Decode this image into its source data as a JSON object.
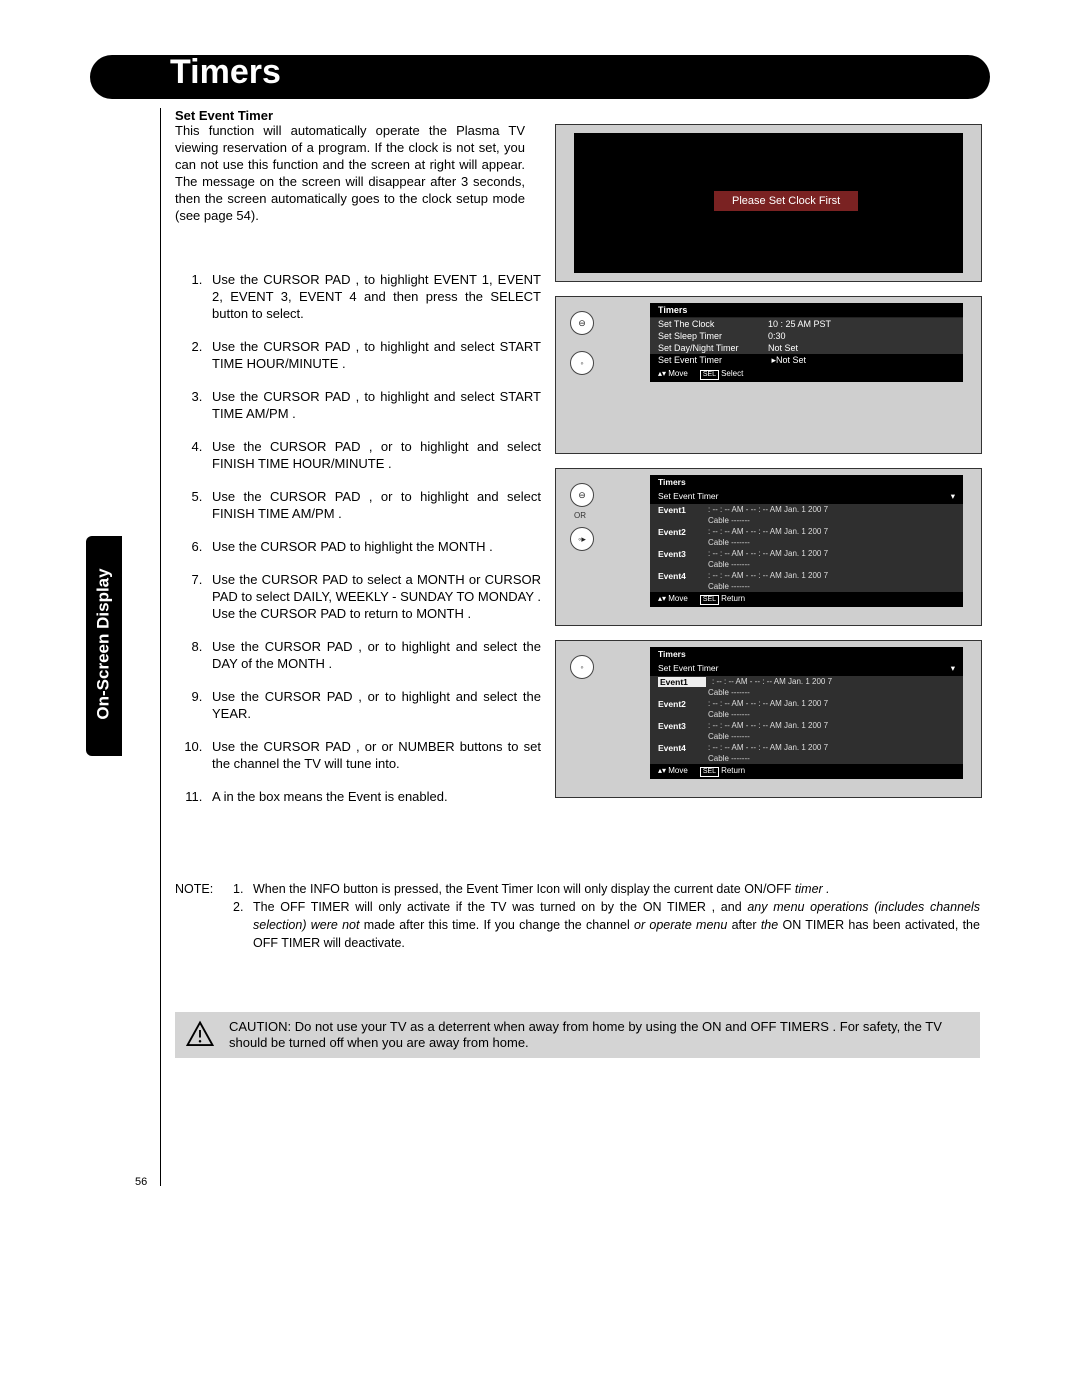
{
  "page": {
    "number": "56",
    "header": "Timers",
    "sideTab": "On-Screen Display"
  },
  "section": {
    "subhead": "Set Event Timer",
    "intro": "This function will automatically operate the Plasma TV viewing reservation of a program. If the clock is not set, you can not use this function and the screen at right will appear. The message on the screen will disappear after 3 seconds, then the screen automatically goes to the clock setup mode (see page 54).",
    "steps": [
      "Use the CURSOR PAD   ,    to highlight EVENT 1, EVENT 2, EVENT 3, EVENT 4 and then press the SELECT button to select.",
      "Use the CURSOR PAD   ,    to highlight and select START TIME HOUR/MINUTE .",
      "Use the CURSOR PAD   ,    to highlight and select START TIME AM/PM .",
      "Use the CURSOR PAD   ,   or    to highlight and select FINISH TIME HOUR/MINUTE .",
      "Use the CURSOR PAD   ,   or    to highlight and select FINISH TIME AM/PM .",
      "Use the CURSOR PAD    to highlight the MONTH .",
      "Use the CURSOR PAD    to select a MONTH  or CURSOR PAD    to select DAILY,  WEEKLY - SUNDAY TO MONDAY . Use the CURSOR PAD    to return to MONTH .",
      "Use the CURSOR PAD   ,   or    to highlight and select the DAY of the MONTH .",
      "Use the CURSOR PAD   ,   or    to highlight and select the YEAR.",
      "Use the CURSOR PAD   ,   or   or NUMBER buttons to set the channel the TV will tune into.",
      "A     in the box means the Event is enabled."
    ]
  },
  "notes": {
    "label": "NOTE:",
    "items": [
      "When the INFO button is pressed, the Event Timer Icon will only display the current date   ON/OFF",
      "The OFF TIMER  will only activate if the TV was turned on by the   ON TIMER ,  and"
    ],
    "item1_tail": "timer .",
    "item2_tail": "any menu operations (includes channels selection) were not",
    "item2_mid": "made after this time. If you change the channel",
    "item2_mid2": "or operate menu",
    "item2_after": "after",
    "item2_line3a": "the",
    "item2_line3b": "ON TIMER has been",
    "item2_line3c": "activated, the  OFF TIMER  will deactivate."
  },
  "caution": "CAUTION:  Do not use your TV as a deterrent when away from home by using the   ON and OFF TIMERS . For safety, the TV should be turned off when you are away from home.",
  "tv1_msg": "Please Set Clock First",
  "orLabel": "OR",
  "menuTimers": {
    "title": "Timers",
    "rows": [
      {
        "k": "Set The Clock",
        "v": "10 : 25 AM PST"
      },
      {
        "k": "Set Sleep Timer",
        "v": "0:30"
      },
      {
        "k": "Set Day/Night Timer",
        "v": "Not Set"
      },
      {
        "k": "Set Event Timer",
        "v": "Not Set",
        "sel": true
      }
    ],
    "footMove": "Move",
    "footSel": "Select",
    "selbox": "SEL"
  },
  "eventMenu": {
    "title": "Timers",
    "sub": "Set Event Timer",
    "events": [
      {
        "lbl": "Event1",
        "t": ":   -- : -- AM   -   -- : -- AM    Jan. 1 200 7",
        "c": "Cable   -------"
      },
      {
        "lbl": "Event2",
        "t": ":   -- : -- AM   -   -- : -- AM    Jan. 1 200 7",
        "c": "Cable   -------"
      },
      {
        "lbl": "Event3",
        "t": ":   -- : -- AM   -   -- : -- AM    Jan. 1 200 7",
        "c": "Cable   -------"
      },
      {
        "lbl": "Event4",
        "t": ":   -- : -- AM   -   -- : -- AM    Jan. 1 200 7",
        "c": "Cable   -------"
      }
    ],
    "footMove": "Move",
    "footSel": "Return",
    "selbox": "SEL"
  }
}
